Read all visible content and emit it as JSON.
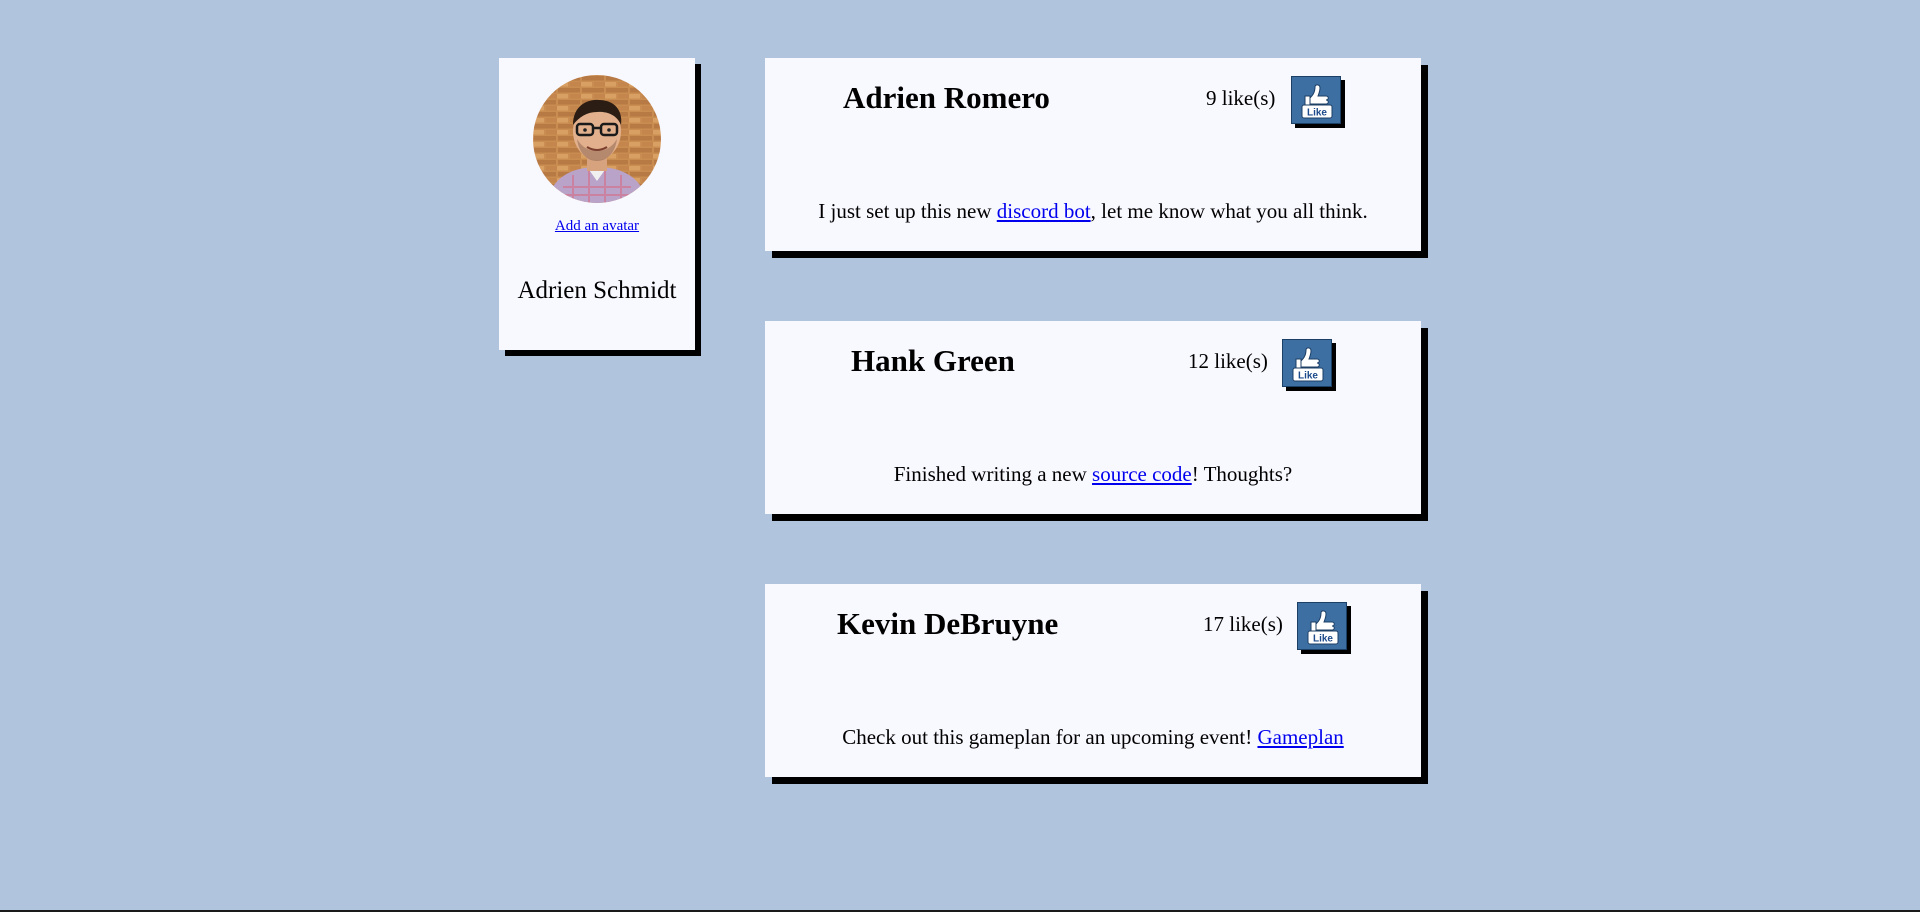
{
  "profile": {
    "name": "Adrien Schmidt",
    "add_avatar_link": "Add an avatar"
  },
  "posts": [
    {
      "author": "Adrien Romero",
      "likes": "9 like(s)",
      "like_button_label": "Like",
      "body_before": "I just set up this new ",
      "link_text": "discord bot",
      "body_after": ", let me know what you all think."
    },
    {
      "author": "Hank Green",
      "likes": "12 like(s)",
      "like_button_label": "Like",
      "body_before": "Finished writing a new ",
      "link_text": "source code",
      "body_after": "! Thoughts?"
    },
    {
      "author": "Kevin DeBruyne",
      "likes": "17 like(s)",
      "like_button_label": "Like",
      "body_before": "Check out this gameplan for an upcoming event! ",
      "link_text": "Gameplan",
      "body_after": ""
    }
  ],
  "colors": {
    "page_background": "#b0c4de",
    "card_background": "#f8f8ff",
    "card_shadow": "#000000",
    "like_button": "#3d6fa3",
    "link": "#0000ee"
  },
  "icons": {
    "like": "thumbs-up-like-icon",
    "avatar": "user-photo-avatar"
  }
}
